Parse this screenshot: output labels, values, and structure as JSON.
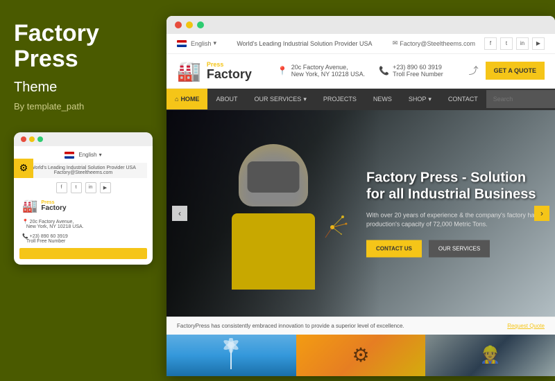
{
  "left_panel": {
    "title_line1": "Factory",
    "title_line2": "Press",
    "subtitle": "Theme",
    "by": "By template_path",
    "mobile_preview": {
      "lang": "English",
      "tagline": "World's Leading Industrial Solution Provider USA",
      "email": "Factory@Steeltheems.com",
      "logo_press": "Press",
      "logo_factory": "Factory",
      "address_line1": "20c Factory Avenue,",
      "address_line2": "New York, NY 10218 USA.",
      "phone": "+23) 890 60 3919",
      "phone_sub": "Troll Free Number"
    }
  },
  "browser": {
    "topbar": {
      "flag_label": "English",
      "tagline": "World's Leading Industrial Solution Provider USA",
      "email": "Factory@Steeltheems.com"
    },
    "header": {
      "logo_press": "Press",
      "logo_factory": "Factory",
      "address_line1": "20c Factory Avenue,",
      "address_line2": "New York, NY 10218 USA.",
      "phone": "+23) 890 60 3919",
      "phone_sub": "Troll Free Number",
      "get_quote": "GET A QUOTE"
    },
    "nav": {
      "items": [
        {
          "label": "HOME",
          "active": true
        },
        {
          "label": "ABOUT",
          "active": false
        },
        {
          "label": "OUR SERVICES",
          "active": false,
          "has_arrow": true
        },
        {
          "label": "PROJECTS",
          "active": false
        },
        {
          "label": "NEWS",
          "active": false
        },
        {
          "label": "SHOP",
          "active": false,
          "has_arrow": true
        },
        {
          "label": "CONTACT",
          "active": false
        }
      ],
      "search_placeholder": "Search"
    },
    "hero": {
      "title": "Factory Press - Solution for all Industrial Business",
      "description": "With over 20 years of experience & the company's factory has production's capacity of 72,000 Metric Tons.",
      "btn_contact": "CONTACT US",
      "btn_services": "OUR SERVICES"
    },
    "bottom_bar": {
      "text": "FactoryPress has consistently embraced innovation to provide a superior level of excellence.",
      "link": "Request Quote"
    },
    "social": {
      "facebook": "f",
      "twitter": "t",
      "linkedin": "in",
      "youtube": "▶"
    }
  }
}
